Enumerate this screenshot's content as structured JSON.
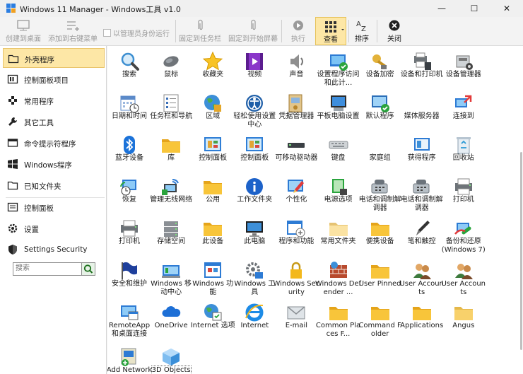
{
  "window": {
    "title": "Windows 11 Manager - Windows工具 v1.0",
    "minimize_glyph": "—",
    "maximize_glyph": "☐",
    "close_glyph": "✕"
  },
  "toolbar": {
    "create_shortcut": "创建到桌面",
    "add_context_menu": "添加到右键菜单",
    "run_as_admin": "以管理员身份运行",
    "pin_taskbar": "固定到任务栏",
    "pin_start": "固定到开始屏幕",
    "execute": "执行",
    "view": "查看",
    "sort": "排序",
    "close": "关闭"
  },
  "sidebar": {
    "items": [
      {
        "label": "外壳程序",
        "icon": "folder-icon"
      },
      {
        "label": "控制面板项目",
        "icon": "control-panel-icon"
      },
      {
        "label": "常用程序",
        "icon": "apps-icon"
      },
      {
        "label": "其它工具",
        "icon": "wrench-icon"
      },
      {
        "label": "命令提示符程序",
        "icon": "terminal-icon"
      },
      {
        "label": "Windows程序",
        "icon": "windows-logo-icon"
      },
      {
        "label": "已知文件夹",
        "icon": "folder-outline-icon"
      },
      {
        "label": "控制面板",
        "icon": "control-panel-list-icon"
      },
      {
        "label": "设置",
        "icon": "gear-icon"
      },
      {
        "label": "Settings Security",
        "icon": "shield-icon"
      }
    ],
    "search_placeholder": "搜索"
  },
  "grid": [
    {
      "label": "搜索",
      "icon": "search-icon"
    },
    {
      "label": "鼠标",
      "icon": "mouse-icon"
    },
    {
      "label": "收藏夹",
      "icon": "star-icon"
    },
    {
      "label": "视频",
      "icon": "video-icon"
    },
    {
      "label": "声音",
      "icon": "speaker-icon"
    },
    {
      "label": "设置程序访问和此计...",
      "icon": "program-access-icon"
    },
    {
      "label": "设备加密",
      "icon": "key-icon"
    },
    {
      "label": "设备和打印机",
      "icon": "devices-printers-icon"
    },
    {
      "label": "设备管理器",
      "icon": "device-manager-icon"
    },
    {
      "label": "日期和时间",
      "icon": "calendar-clock-icon"
    },
    {
      "label": "任务栏和导航",
      "icon": "taskbar-icon"
    },
    {
      "label": "区域",
      "icon": "globe-icon"
    },
    {
      "label": "轻松使用设置中心",
      "icon": "ease-of-access-icon"
    },
    {
      "label": "凭据管理器",
      "icon": "credential-icon"
    },
    {
      "label": "平板电脑设置",
      "icon": "tablet-icon"
    },
    {
      "label": "默认程序",
      "icon": "default-programs-icon"
    },
    {
      "label": "媒体服务器",
      "icon": "media-server-icon"
    },
    {
      "label": "连接到",
      "icon": "connect-icon"
    },
    {
      "label": "蓝牙设备",
      "icon": "bluetooth-icon"
    },
    {
      "label": "库",
      "icon": "library-folder-icon"
    },
    {
      "label": "控制面板",
      "icon": "control-panel-icon"
    },
    {
      "label": "控制面板",
      "icon": "control-panel-icon"
    },
    {
      "label": "可移动驱动器",
      "icon": "removable-drive-icon"
    },
    {
      "label": "键盘",
      "icon": "keyboard-icon"
    },
    {
      "label": "家庭组",
      "icon": "homegroup-icon"
    },
    {
      "label": "获得程序",
      "icon": "get-programs-icon"
    },
    {
      "label": "回收站",
      "icon": "recycle-bin-icon"
    },
    {
      "label": "恢复",
      "icon": "recovery-icon"
    },
    {
      "label": "管理无线网络",
      "icon": "wireless-network-icon"
    },
    {
      "label": "公用",
      "icon": "public-folder-icon"
    },
    {
      "label": "工作文件夹",
      "icon": "info-icon"
    },
    {
      "label": "个性化",
      "icon": "personalization-icon"
    },
    {
      "label": "电源选项",
      "icon": "power-options-icon"
    },
    {
      "label": "电话和调制解调器",
      "icon": "phone-modem-icon"
    },
    {
      "label": "电话和调制解调器",
      "icon": "phone-modem-icon"
    },
    {
      "label": "打印机",
      "icon": "printer-icon"
    },
    {
      "label": "打印机",
      "icon": "printer-icon"
    },
    {
      "label": "存储空间",
      "icon": "storage-icon"
    },
    {
      "label": "此设备",
      "icon": "folder-icon"
    },
    {
      "label": "此电脑",
      "icon": "monitor-icon"
    },
    {
      "label": "程序和功能",
      "icon": "programs-features-icon"
    },
    {
      "label": "常用文件夹",
      "icon": "common-folder-icon"
    },
    {
      "label": "便携设备",
      "icon": "folder-icon"
    },
    {
      "label": "笔和触控",
      "icon": "pen-icon"
    },
    {
      "label": "备份和还原 (Windows 7)",
      "icon": "backup-icon"
    },
    {
      "label": "安全和维护",
      "icon": "flag-icon"
    },
    {
      "label": "Windows 移动中心",
      "icon": "mobility-center-icon"
    },
    {
      "label": "Windows 功能",
      "icon": "windows-features-icon"
    },
    {
      "label": "Windows 工具",
      "icon": "windows-tools-icon"
    },
    {
      "label": "Windows Security",
      "icon": "lock-icon"
    },
    {
      "label": "Windows Defender ...",
      "icon": "firewall-icon"
    },
    {
      "label": "User Pinned",
      "icon": "folder-icon"
    },
    {
      "label": "User Accounts",
      "icon": "users-icon"
    },
    {
      "label": "User Accounts",
      "icon": "users-icon"
    },
    {
      "label": "RemoteApp 和桌面连接",
      "icon": "remote-app-icon"
    },
    {
      "label": "OneDrive",
      "icon": "cloud-icon"
    },
    {
      "label": "Internet 选项",
      "icon": "internet-options-icon"
    },
    {
      "label": "Internet",
      "icon": "ie-icon"
    },
    {
      "label": "E-mail",
      "icon": "envelope-icon"
    },
    {
      "label": "Common Places F...",
      "icon": "folder-icon"
    },
    {
      "label": "Command Folder",
      "icon": "folder-icon"
    },
    {
      "label": "Applications",
      "icon": "folder-icon"
    },
    {
      "label": "Angus",
      "icon": "folder-plain-icon"
    },
    {
      "label": "Add Network",
      "icon": "add-network-icon"
    },
    {
      "label": "3D Objects",
      "icon": "cube-3d-icon"
    }
  ]
}
